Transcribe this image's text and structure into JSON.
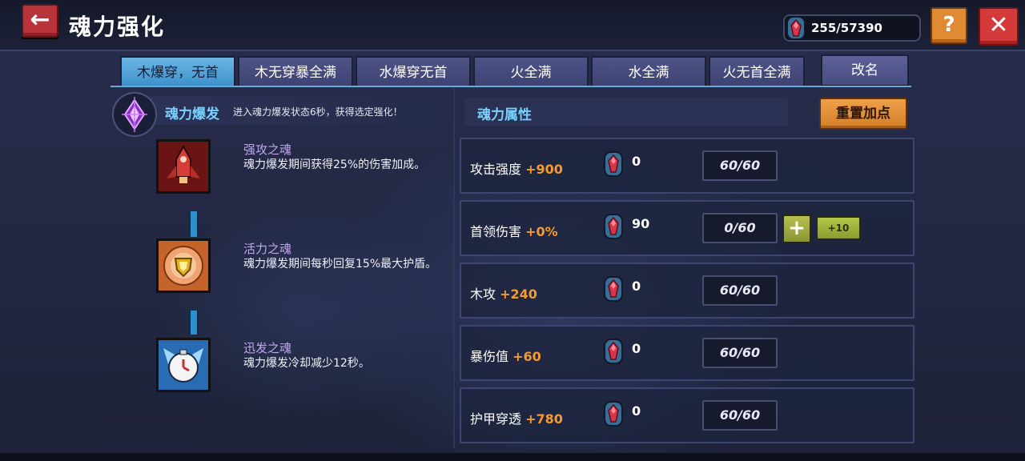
{
  "header": {
    "back_label": "←",
    "title": "魂力强化",
    "currency_value": "255/57390",
    "help_label": "?",
    "close_label": "✕"
  },
  "tabs": [
    {
      "label": "木爆穿，无首",
      "active": true
    },
    {
      "label": "木无穿暴全满",
      "active": false
    },
    {
      "label": "水爆穿无首",
      "active": false
    },
    {
      "label": "火全满",
      "active": false
    },
    {
      "label": "水全满",
      "active": false
    },
    {
      "label": "火无首全满",
      "active": false
    }
  ],
  "rename_label": "改名",
  "burst": {
    "title": "魂力爆发",
    "desc": "进入魂力爆发状态6秒，获得选定强化！"
  },
  "souls": [
    {
      "name": "强攻之魂",
      "desc": "魂力爆发期间获得25%的伤害加成。",
      "icon": "red-rocket-icon"
    },
    {
      "name": "活力之魂",
      "desc": "魂力爆发期间每秒回复15%最大护盾。",
      "icon": "orange-shield-icon"
    },
    {
      "name": "迅发之魂",
      "desc": "魂力爆发冷却减少12秒。",
      "icon": "blue-clock-icon"
    }
  ],
  "attributes_title": "魂力属性",
  "reset_label": "重置加点",
  "attributes": [
    {
      "name": "攻击强度",
      "bonus": "+900",
      "cost": "0",
      "level": "60/60"
    },
    {
      "name": "首领伤害",
      "bonus": "+0%",
      "cost": "90",
      "level": "0/60",
      "plus_label": "+",
      "plus10_label": "+10"
    },
    {
      "name": "木攻",
      "bonus": "+240",
      "cost": "0",
      "level": "60/60"
    },
    {
      "name": "暴伤值",
      "bonus": "+60",
      "cost": "0",
      "level": "60/60"
    },
    {
      "name": "护甲穿透",
      "bonus": "+780",
      "cost": "0",
      "level": "60/60"
    }
  ],
  "colors": {
    "tab_active": "#4fa3db",
    "bonus_orange": "#f39b2e",
    "title_blue": "#7ad0ff",
    "close_red": "#d43a3a",
    "help_orange": "#e08a34"
  }
}
